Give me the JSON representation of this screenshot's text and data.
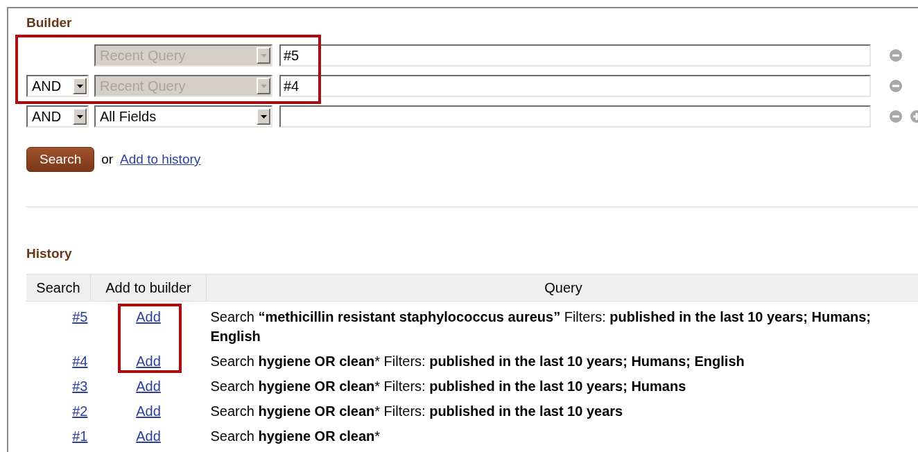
{
  "builder": {
    "title": "Builder",
    "rows": [
      {
        "operator": null,
        "field": "Recent Query",
        "field_disabled": true,
        "value": "#5",
        "highlighted": true,
        "can_add": false
      },
      {
        "operator": "AND",
        "field": "Recent Query",
        "field_disabled": true,
        "value": "#4",
        "highlighted": true,
        "can_add": false
      },
      {
        "operator": "AND",
        "field": "All Fields",
        "field_disabled": false,
        "value": "",
        "highlighted": false,
        "can_add": true
      }
    ],
    "search_button": "Search",
    "or_text": "or",
    "add_link": "Add to history"
  },
  "history": {
    "title": "History",
    "columns": [
      "Search",
      "Add to builder",
      "Query"
    ],
    "rows": [
      {
        "search": "#5",
        "add": "Add",
        "query": "Search **“methicillin resistant staphylococcus aureus”** Filters: **published in the last 10 years; Humans; English**",
        "highlighted": true
      },
      {
        "search": "#4",
        "add": "Add",
        "query": "Search **hygiene OR clean*** Filters: **published in the last 10 years; Humans; English**",
        "highlighted": true
      },
      {
        "search": "#3",
        "add": "Add",
        "query": "Search **hygiene OR clean*** Filters: **published in the last 10 years; Humans**",
        "highlighted": false
      },
      {
        "search": "#2",
        "add": "Add",
        "query": "Search **hygiene OR clean*** Filters: **published in the last 10 years**",
        "highlighted": false
      },
      {
        "search": "#1",
        "add": "Add",
        "query": "Search **hygiene OR clean***",
        "highlighted": false
      }
    ]
  }
}
